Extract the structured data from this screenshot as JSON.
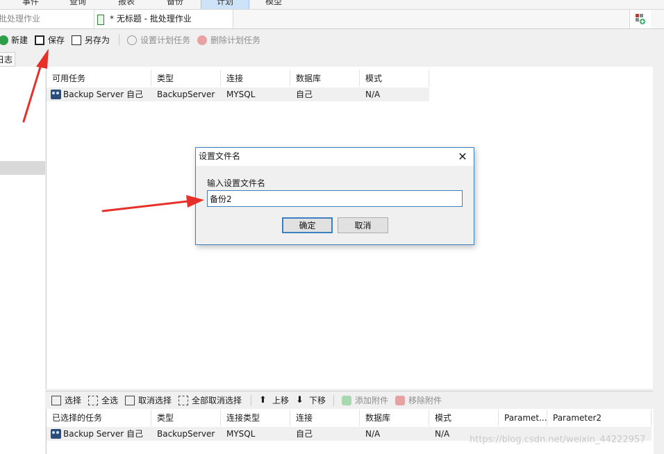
{
  "ribbon": {
    "tabs": [
      "事件",
      "查询",
      "报表",
      "备份",
      "计划",
      "模型"
    ],
    "active_tab": "计划"
  },
  "doc_tabs": {
    "tab1": "批处理作业",
    "tab2": "* 无标题 - 批处理作业"
  },
  "toolbar": {
    "new_label": "新建",
    "save_label": "保存",
    "save_as_label": "另存为",
    "set_schedule_label": "设置计划任务",
    "delete_schedule_label": "删除计划任务"
  },
  "sidebar": {
    "tab_label": "日志"
  },
  "available_tasks": {
    "columns": [
      "可用任务",
      "类型",
      "连接",
      "数据库",
      "模式"
    ],
    "rows": [
      [
        "Backup Server 自己",
        "BackupServer",
        "MYSQL",
        "自己",
        "N/A"
      ]
    ]
  },
  "lower_toolbar": {
    "select_label": "选择",
    "select_all_label": "全选",
    "deselect_label": "取消选择",
    "deselect_all_label": "全部取消选择",
    "move_up_label": "上移",
    "move_down_label": "下移",
    "add_attachment_label": "添加附件",
    "remove_attachment_label": "移除附件"
  },
  "selected_tasks": {
    "columns": [
      "已选择的任务",
      "类型",
      "连接类型",
      "连接",
      "数据库",
      "模式",
      "Paramet...",
      "Parameter2"
    ],
    "rows": [
      [
        "Backup Server 自己",
        "BackupServer",
        "MYSQL",
        "自己",
        "N/A",
        "N/A",
        "",
        ""
      ]
    ]
  },
  "dialog": {
    "title": "设置文件名",
    "label": "输入设置文件名",
    "input_value": "备份2",
    "ok_label": "确定",
    "cancel_label": "取消",
    "close_glyph": "✕"
  },
  "watermark": "https://blog.csdn.net/weixin_44222957",
  "colors": {
    "annotation_arrow": "#e8302a",
    "dialog_border": "#3c7fc1",
    "active_ribbon_tab": "#cde3f7"
  }
}
